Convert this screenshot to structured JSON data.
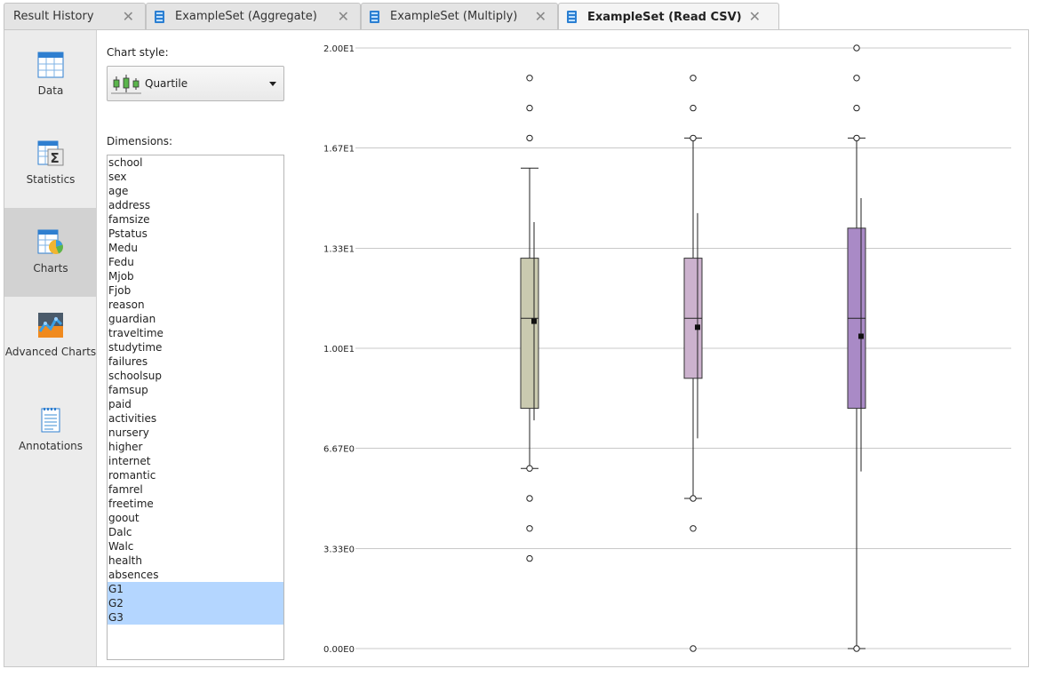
{
  "tabs": [
    {
      "label": "Result History",
      "active": false,
      "icon": false
    },
    {
      "label": "ExampleSet (Aggregate)",
      "active": false,
      "icon": true
    },
    {
      "label": "ExampleSet (Multiply)",
      "active": false,
      "icon": true
    },
    {
      "label": "ExampleSet (Read CSV)",
      "active": true,
      "icon": true
    }
  ],
  "close_glyph": "✕",
  "sidenav": {
    "items": [
      {
        "label": "Data",
        "icon": "table-grid-icon"
      },
      {
        "label": "Statistics",
        "icon": "sigma-table-icon"
      },
      {
        "label": "Charts",
        "icon": "pie-chart-icon",
        "active": true
      },
      {
        "label": "Advanced Charts",
        "icon": "advanced-chart-icon"
      },
      {
        "label": "Annotations",
        "icon": "notepad-icon"
      }
    ]
  },
  "config": {
    "chart_style_label": "Chart style:",
    "chart_style_value": "Quartile",
    "dimensions_label": "Dimensions:",
    "dimensions": [
      "school",
      "sex",
      "age",
      "address",
      "famsize",
      "Pstatus",
      "Medu",
      "Fedu",
      "Mjob",
      "Fjob",
      "reason",
      "guardian",
      "traveltime",
      "studytime",
      "failures",
      "schoolsup",
      "famsup",
      "paid",
      "activities",
      "nursery",
      "higher",
      "internet",
      "romantic",
      "famrel",
      "freetime",
      "goout",
      "Dalc",
      "Walc",
      "health",
      "absences",
      "G1",
      "G2",
      "G3"
    ],
    "selected_dimensions": [
      "G1",
      "G2",
      "G3"
    ]
  },
  "chart_data": {
    "type": "box",
    "y_ticks": [
      {
        "value": 20.0,
        "label": "2.00E1"
      },
      {
        "value": 16.67,
        "label": "1.67E1"
      },
      {
        "value": 13.33,
        "label": "1.33E1"
      },
      {
        "value": 10.0,
        "label": "1.00E1"
      },
      {
        "value": 6.67,
        "label": "6.67E0"
      },
      {
        "value": 3.33,
        "label": "3.33E0"
      },
      {
        "value": 0.0,
        "label": "0.00E0"
      }
    ],
    "ylim": [
      0,
      20
    ],
    "grid": true,
    "series": [
      {
        "color": "#cacab0",
        "q1": 8,
        "median": 11,
        "q3": 13,
        "mean": 10.9,
        "whisker_low": 6,
        "whisker_high": 16,
        "sd_low": 7.6,
        "sd_high": 14.2,
        "outliers": [
          19,
          18,
          17,
          6,
          5,
          4,
          3
        ]
      },
      {
        "color": "#ccb2ce",
        "q1": 9,
        "median": 11,
        "q3": 13,
        "mean": 10.7,
        "whisker_low": 5,
        "whisker_high": 17,
        "sd_low": 7.0,
        "sd_high": 14.5,
        "outliers": [
          19,
          18,
          17,
          5,
          4,
          0
        ]
      },
      {
        "color": "#a98ac6",
        "q1": 8,
        "median": 11,
        "q3": 14,
        "mean": 10.4,
        "whisker_low": 0,
        "whisker_high": 17,
        "sd_low": 5.9,
        "sd_high": 15.0,
        "outliers": [
          20,
          19,
          18,
          17,
          0
        ]
      }
    ]
  }
}
